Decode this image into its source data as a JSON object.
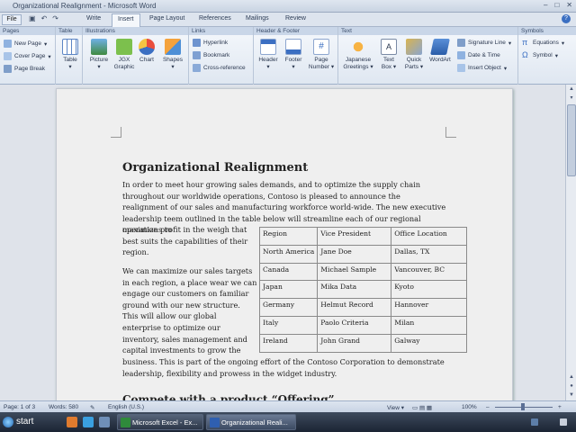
{
  "window": {
    "title": "Organizational Realignment - Microsoft Word"
  },
  "menu": {
    "file_label": "File",
    "tabs": [
      "Write",
      "Insert",
      "Page Layout",
      "References",
      "Mailings",
      "Review"
    ],
    "active_tab": "Insert",
    "help": "?"
  },
  "ribbon": {
    "groups": [
      "Pages",
      "Table",
      "Illustrations",
      "Links",
      "Header & Footer",
      "Text",
      "Symbols"
    ],
    "pages": {
      "new_page": "New Page",
      "cover_page": "Cover Page",
      "page_break": "Page Break"
    },
    "table": {
      "table": "Table"
    },
    "illustrations": {
      "picture": "Picture",
      "jgx_line1": "JGX",
      "jgx_line2": "Graphic",
      "chart": "Chart",
      "shapes": "Shapes"
    },
    "links": {
      "hyperlink": "Hyperlink",
      "bookmark": "Bookmark",
      "cross_reference": "Cross-reference"
    },
    "header_footer": {
      "header": "Header",
      "footer": "Footer",
      "page_line1": "Page",
      "page_line2": "Number"
    },
    "text": {
      "jg_line1": "Japanese",
      "jg_line2": "Greetings",
      "tb_line1": "Text",
      "tb_line2": "Box",
      "qp_line1": "Quick",
      "qp_line2": "Parts",
      "wordart": "WordArt",
      "signature_line": "Signature Line",
      "date_time": "Date & Time",
      "insert_object": "Insert Object"
    },
    "symbols": {
      "equations": "Equations",
      "symbol": "Symbol"
    }
  },
  "document": {
    "title": "Organizational Realignment",
    "p1": "In order to meet hour growing sales demands, and to optimize the supply chain throughout our worldwide operations, Contoso is pleased to announce the realignment of our sales and manufacturing workforce world-wide. The new executive leadership teem outlined in the table below will streamline each of our regional operations to",
    "p2": "maximize profit in the weigh that best suits the capabilities of their region.",
    "p3": "We can maximize our sales targets in each region, a place wear we can engage our customers on familiar ground with our new structure. This will allow our global enterprise to optimize our inventory, sales management and capital investments to grow the",
    "p4": "business. This is part of the ongoing effort of the Contoso Corporation to demonstrate leadership, flexibility and prowess in the widget industry.",
    "heading2": "Compete with a product “Offering”",
    "table": {
      "headers": [
        "Region",
        "Vice President",
        "Office Location"
      ],
      "rows": [
        [
          "North America",
          "Jane Doe",
          "Dallas, TX"
        ],
        [
          "Canada",
          "Michael Sample",
          "Vancouver, BC"
        ],
        [
          "Japan",
          "Mika Data",
          "Kyoto"
        ],
        [
          "Germany",
          "Helmut Record",
          "Hannover"
        ],
        [
          "Italy",
          "Paolo Criteria",
          "Milan"
        ],
        [
          "Ireland",
          "John Grand",
          "Galway"
        ]
      ]
    }
  },
  "status": {
    "page": "Page: 1 of 3",
    "words": "Words: 580",
    "language": "English (U.S.)",
    "view": "View",
    "zoom": "100%"
  },
  "taskbar": {
    "start": "start",
    "tasks": [
      "Microsoft Excel - Ex...",
      "Organizational Reali..."
    ],
    "active_task": 1
  },
  "colors": {
    "accent": "#3b6fc2",
    "ribbon_bg": "#dfe7f1",
    "taskbar": "#1b2433"
  }
}
